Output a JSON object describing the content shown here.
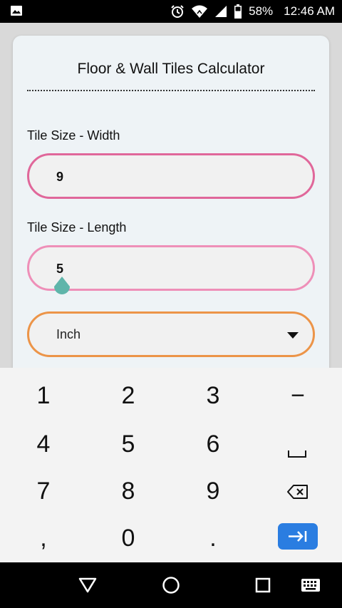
{
  "status_bar": {
    "battery": "58%",
    "time": "12:46 AM"
  },
  "card": {
    "title": "Floor & Wall Tiles Calculator",
    "width_label": "Tile Size - Width",
    "width_value": "9",
    "length_label": "Tile Size - Length",
    "length_value": "5",
    "unit_selected": "Inch"
  },
  "keyboard": {
    "rows": [
      [
        "1",
        "2",
        "3"
      ],
      [
        "4",
        "5",
        "6"
      ],
      [
        "7",
        "8",
        "9"
      ],
      [
        ",",
        "0",
        "."
      ]
    ],
    "minus": "−"
  },
  "colors": {
    "width_border": "#e0679a",
    "length_border": "#ee8fb8",
    "unit_border": "#ec9448",
    "go_key": "#2a7de1",
    "cursor_handle": "#5fb5aa"
  },
  "icons": {
    "status_left": "image-icon",
    "alarm": "alarm-clock-icon",
    "wifi": "wifi-icon",
    "signal": "signal-icon",
    "battery": "battery-icon",
    "space": "space-bar-icon",
    "backspace": "backspace-icon",
    "go": "tab-next-icon",
    "nav_back": "back-triangle-icon",
    "nav_home": "home-circle-icon",
    "nav_recents": "recents-square-icon",
    "nav_keyboard": "keyboard-icon"
  }
}
